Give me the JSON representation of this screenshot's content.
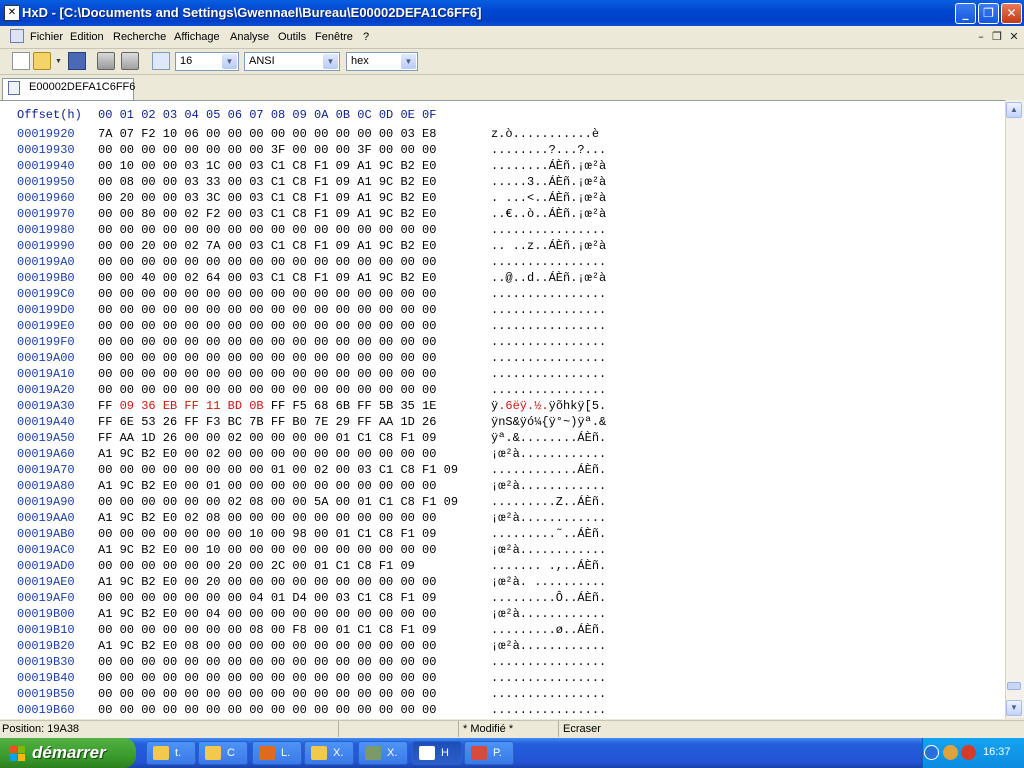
{
  "window": {
    "title": "HxD - [C:\\Documents and Settings\\Gwennael\\Bureau\\E00002DEFA1C6FF6]",
    "app_icon_glyph": "✕",
    "minimize": "_",
    "restore": "❐",
    "close": "✕"
  },
  "menu": {
    "items": [
      "Fichier",
      "Edition",
      "Recherche",
      "Affichage",
      "Analyse",
      "Outils",
      "Fenêtre",
      "?"
    ],
    "mdi_minimize": "–",
    "mdi_restore": "❐",
    "mdi_close": "✕"
  },
  "toolbar": {
    "bytes_per_row": "16",
    "charset": "ANSI",
    "offset_base": "hex",
    "icons": [
      "new-file-icon",
      "open-file-icon",
      "save-icon",
      "disk-icon",
      "disks-icon",
      "row-width-icon"
    ]
  },
  "tab": {
    "label": "E00002DEFA1C6FF6"
  },
  "editor": {
    "header_offset": "Offset(h)",
    "header_columns": "00 01 02 03 04 05 06 07 08 09 0A 0B 0C 0D 0E 0F",
    "rows": [
      {
        "offset": "00019920",
        "hex": "7A 07 F2 10 06 00 00 00 00 00 00 00 00 00 03 E8",
        "ascii": "z.ò...........è"
      },
      {
        "offset": "00019930",
        "hex": "00 00 00 00 00 00 00 00 3F 00 00 00 3F 00 00 00",
        "ascii": "........?...?..."
      },
      {
        "offset": "00019940",
        "hex": "00 10 00 00 03 1C 00 03 C1 C8 F1 09 A1 9C B2 E0",
        "ascii": "........ÁÈñ.¡œ²à"
      },
      {
        "offset": "00019950",
        "hex": "00 08 00 00 03 33 00 03 C1 C8 F1 09 A1 9C B2 E0",
        "ascii": ".....3..ÁÈñ.¡œ²à"
      },
      {
        "offset": "00019960",
        "hex": "00 20 00 00 03 3C 00 03 C1 C8 F1 09 A1 9C B2 E0",
        "ascii": ". ...<..ÁÈñ.¡œ²à"
      },
      {
        "offset": "00019970",
        "hex": "00 00 80 00 02 F2 00 03 C1 C8 F1 09 A1 9C B2 E0",
        "ascii": "..€..ò..ÁÈñ.¡œ²à"
      },
      {
        "offset": "00019980",
        "hex": "00 00 00 00 00 00 00 00 00 00 00 00 00 00 00 00",
        "ascii": "................"
      },
      {
        "offset": "00019990",
        "hex": "00 00 20 00 02 7A 00 03 C1 C8 F1 09 A1 9C B2 E0",
        "ascii": ".. ..z..ÁÈñ.¡œ²à"
      },
      {
        "offset": "000199A0",
        "hex": "00 00 00 00 00 00 00 00 00 00 00 00 00 00 00 00",
        "ascii": "................"
      },
      {
        "offset": "000199B0",
        "hex": "00 00 40 00 02 64 00 03 C1 C8 F1 09 A1 9C B2 E0",
        "ascii": "..@..d..ÁÈñ.¡œ²à"
      },
      {
        "offset": "000199C0",
        "hex": "00 00 00 00 00 00 00 00 00 00 00 00 00 00 00 00",
        "ascii": "................"
      },
      {
        "offset": "000199D0",
        "hex": "00 00 00 00 00 00 00 00 00 00 00 00 00 00 00 00",
        "ascii": "................"
      },
      {
        "offset": "000199E0",
        "hex": "00 00 00 00 00 00 00 00 00 00 00 00 00 00 00 00",
        "ascii": "................"
      },
      {
        "offset": "000199F0",
        "hex": "00 00 00 00 00 00 00 00 00 00 00 00 00 00 00 00",
        "ascii": "................"
      },
      {
        "offset": "00019A00",
        "hex": "00 00 00 00 00 00 00 00 00 00 00 00 00 00 00 00",
        "ascii": "................"
      },
      {
        "offset": "00019A10",
        "hex": "00 00 00 00 00 00 00 00 00 00 00 00 00 00 00 00",
        "ascii": "................"
      },
      {
        "offset": "00019A20",
        "hex": "00 00 00 00 00 00 00 00 00 00 00 00 00 00 00 00",
        "ascii": "................"
      },
      {
        "offset": "00019A30",
        "hex_pre": "FF ",
        "hex_hl": "09 36 EB FF 11 BD 0B",
        "hex_post": " FF F5 68 6B FF 5B 35 1E",
        "ascii_pre": "ÿ",
        "ascii_hl": ".6ëÿ.½.",
        "ascii_post": "ÿõhkÿ[5."
      },
      {
        "offset": "00019A40",
        "hex": "FF 6E 53 26 FF F3 BC 7B FF B0 7E 29 FF AA 1D 26",
        "ascii": "ÿnS&ÿó¼{ÿ°~)ÿª.&"
      },
      {
        "offset": "00019A50",
        "hex": "FF AA 1D 26 00 00 02 00 00 00 00 01 C1 C8 F1 09",
        "ascii": "ÿª.&........ÁÈñ."
      },
      {
        "offset": "00019A60",
        "hex": "A1 9C B2 E0 00 02 00 00 00 00 00 00 00 00 00 00",
        "ascii": "¡œ²à............"
      },
      {
        "offset": "00019A70",
        "hex": "00 00 00 00 00 00 00 00 01 00 02 00 03 C1 C8 F1 09",
        "ascii": "............ÁÈñ."
      },
      {
        "offset": "00019A80",
        "hex": "A1 9C B2 E0 00 01 00 00 00 00 00 00 00 00 00 00",
        "ascii": "¡œ²à............"
      },
      {
        "offset": "00019A90",
        "hex": "00 00 00 00 00 00 02 08 00 00 5A 00 01 C1 C8 F1 09",
        "ascii": ".........Z..ÁÈñ."
      },
      {
        "offset": "00019AA0",
        "hex": "A1 9C B2 E0 02 08 00 00 00 00 00 00 00 00 00 00",
        "ascii": "¡œ²à............"
      },
      {
        "offset": "00019AB0",
        "hex": "00 00 00 00 00 00 00 10 00 98 00 01 C1 C8 F1 09",
        "ascii": ".........˜..ÁÈñ."
      },
      {
        "offset": "00019AC0",
        "hex": "A1 9C B2 E0 00 10 00 00 00 00 00 00 00 00 00 00",
        "ascii": "¡œ²à............"
      },
      {
        "offset": "00019AD0",
        "hex": "00 00 00 00 00 00 20 00 2C 00 01 C1 C8 F1 09",
        "ascii": "....... .,..ÁÈñ."
      },
      {
        "offset": "00019AE0",
        "hex": "A1 9C B2 E0 00 20 00 00 00 00 00 00 00 00 00 00",
        "ascii": "¡œ²à. .........."
      },
      {
        "offset": "00019AF0",
        "hex": "00 00 00 00 00 00 00 04 01 D4 00 03 C1 C8 F1 09",
        "ascii": ".........Ô..ÁÈñ."
      },
      {
        "offset": "00019B00",
        "hex": "A1 9C B2 E0 00 04 00 00 00 00 00 00 00 00 00 00",
        "ascii": "¡œ²à............"
      },
      {
        "offset": "00019B10",
        "hex": "00 00 00 00 00 00 00 08 00 F8 00 01 C1 C8 F1 09",
        "ascii": ".........ø..ÁÈñ."
      },
      {
        "offset": "00019B20",
        "hex": "A1 9C B2 E0 08 00 00 00 00 00 00 00 00 00 00 00",
        "ascii": "¡œ²à............"
      },
      {
        "offset": "00019B30",
        "hex": "00 00 00 00 00 00 00 00 00 00 00 00 00 00 00 00",
        "ascii": "................"
      },
      {
        "offset": "00019B40",
        "hex": "00 00 00 00 00 00 00 00 00 00 00 00 00 00 00 00",
        "ascii": "................"
      },
      {
        "offset": "00019B50",
        "hex": "00 00 00 00 00 00 00 00 00 00 00 00 00 00 00 00",
        "ascii": "................"
      },
      {
        "offset": "00019B60",
        "hex": "00 00 00 00 00 00 00 00 00 00 00 00 00 00 00 00",
        "ascii": "................"
      }
    ]
  },
  "status": {
    "position": "Position: 19A38",
    "modified": "* Modifié *",
    "mode": "Ecraser"
  },
  "taskbar": {
    "start_label": "démarrer",
    "tasks": [
      {
        "label": "t.",
        "icon": "folder-icon",
        "color": "#f2c94c"
      },
      {
        "label": "C",
        "icon": "folder-icon",
        "color": "#f2c94c"
      },
      {
        "label": "L.",
        "icon": "firefox-icon",
        "color": "#e06a1b"
      },
      {
        "label": "X.",
        "icon": "folder-icon",
        "color": "#f2c94c"
      },
      {
        "label": "X.",
        "icon": "app-icon",
        "color": "#7a9a6a"
      },
      {
        "label": "H",
        "icon": "hxd-icon",
        "color": "#ffffff"
      },
      {
        "label": "P.",
        "icon": "paint-icon",
        "color": "#d84a3a"
      }
    ],
    "clock": "16:37"
  },
  "colors": {
    "offset_blue": "#1c3ea8",
    "highlight_red": "#d01414",
    "title_blue": "#0047d0",
    "start_green": "#3a9c2c"
  }
}
